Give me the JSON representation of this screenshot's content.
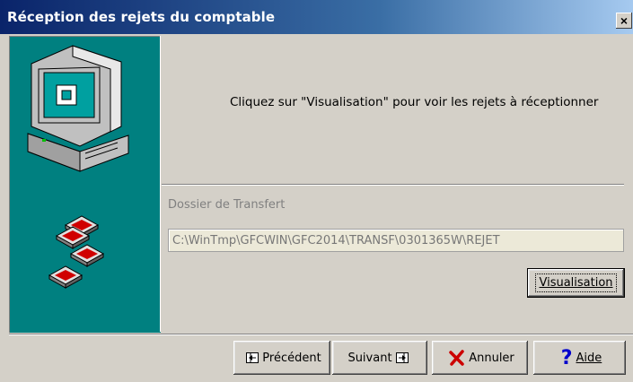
{
  "window": {
    "title": "Réception des rejets du comptable",
    "close_glyph": "×"
  },
  "main": {
    "message": "Cliquez sur \"Visualisation\" pour voir les rejets à réceptionner",
    "folder_label": "Dossier de Transfert",
    "folder_value": "C:\\WinTmp\\GFCWIN\\GFC2014\\TRANSF\\0301365W\\REJET",
    "visualisation_label": "Visualisation"
  },
  "footer": {
    "prev_label": "Précédent",
    "next_label": "Suivant",
    "cancel_label": "Annuler",
    "help_label": "Aide"
  },
  "icons": {
    "illustration": "computer-with-diskettes-icon",
    "prev": "arrow-left-icon",
    "next": "arrow-right-icon",
    "cancel": "red-x-icon",
    "help": "blue-question-mark-icon"
  },
  "colors": {
    "titlebar_start": "#0a246a",
    "titlebar_end": "#a6caf0",
    "panel_teal": "#008080",
    "cancel_red": "#cc0000",
    "help_blue": "#0000cc"
  }
}
